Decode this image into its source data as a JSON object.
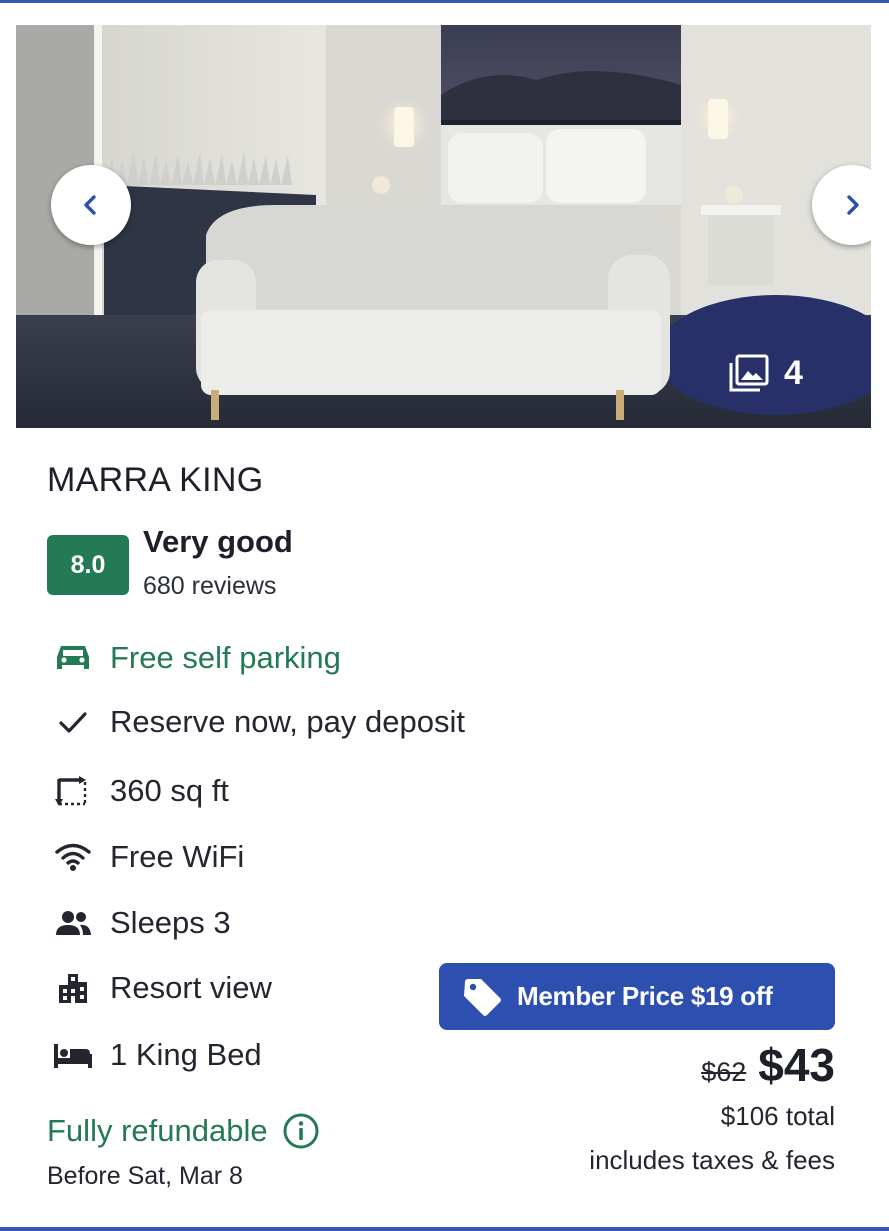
{
  "room": {
    "name": "MARRA KING",
    "photo_count": "4"
  },
  "rating": {
    "score": "8.0",
    "label": "Very good",
    "reviews": "680 reviews"
  },
  "amenities": [
    {
      "icon": "car-icon",
      "label": "Free self parking",
      "highlight": true
    },
    {
      "icon": "checkmark-icon",
      "label": "Reserve now, pay deposit",
      "highlight": false
    },
    {
      "icon": "room-size-icon",
      "label": "360 sq ft",
      "highlight": false
    },
    {
      "icon": "wifi-icon",
      "label": "Free WiFi",
      "highlight": false
    },
    {
      "icon": "people-icon",
      "label": "Sleeps 3",
      "highlight": false
    },
    {
      "icon": "building-icon",
      "label": "Resort view",
      "highlight": false
    },
    {
      "icon": "bed-icon",
      "label": "1 King Bed",
      "highlight": false
    }
  ],
  "refund": {
    "label": "Fully refundable",
    "deadline": "Before Sat, Mar 8"
  },
  "pricing": {
    "member_badge": "Member Price $19 off",
    "old_price": "$62",
    "price": "$43",
    "total": "$106 total",
    "taxes_note": "includes taxes & fees"
  },
  "colors": {
    "brand_blue": "#2c4fb0",
    "rating_green": "#237a54",
    "text_dark": "#1d2029"
  }
}
